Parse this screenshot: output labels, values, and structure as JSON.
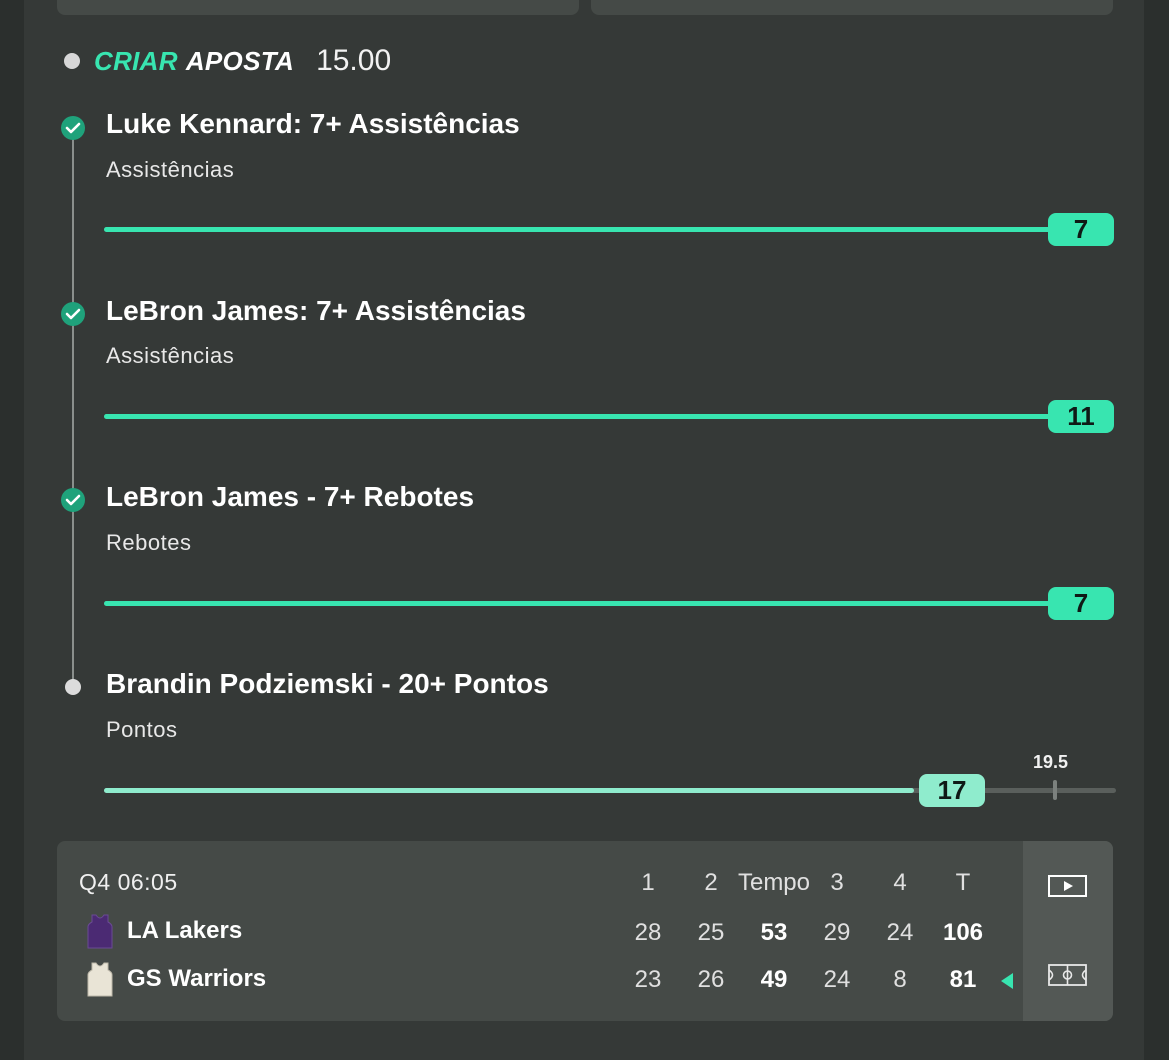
{
  "bet": {
    "brand_part1": "CRIAR",
    "brand_part2": "APOSTA",
    "odds": "15.00"
  },
  "legs": [
    {
      "title": "Luke Kennard: 7+ Assistências",
      "market": "Assistências",
      "value": "7",
      "status": "won",
      "progress_percent": 100
    },
    {
      "title": "LeBron James: 7+ Assistências",
      "market": "Assistências",
      "value": "11",
      "status": "won",
      "progress_percent": 100
    },
    {
      "title": "LeBron James - 7+ Rebotes",
      "market": "Rebotes",
      "value": "7",
      "status": "won",
      "progress_percent": 100
    },
    {
      "title": "Brandin Podziemski - 20+ Pontos",
      "market": "Pontos",
      "value": "17",
      "target": "19.5",
      "status": "pending",
      "progress_percent": 80
    }
  ],
  "scoreboard": {
    "clock": "Q4 06:05",
    "headers": [
      "1",
      "2",
      "Tempo",
      "3",
      "4",
      "T"
    ],
    "teams": [
      {
        "name": "LA Lakers",
        "scores": [
          "28",
          "25",
          "53",
          "29",
          "24",
          "106"
        ],
        "jersey_color": "#4b2a73"
      },
      {
        "name": "GS Warriors",
        "scores": [
          "23",
          "26",
          "49",
          "24",
          "8",
          "81"
        ],
        "jersey_color": "#e9e4d6"
      }
    ],
    "possession_team": "GS Warriors"
  },
  "colors": {
    "accent": "#38e5b0",
    "accent_light": "#8feccd",
    "background": "#353937"
  },
  "icons": {
    "video": "video-play-icon",
    "court": "court-icon"
  }
}
